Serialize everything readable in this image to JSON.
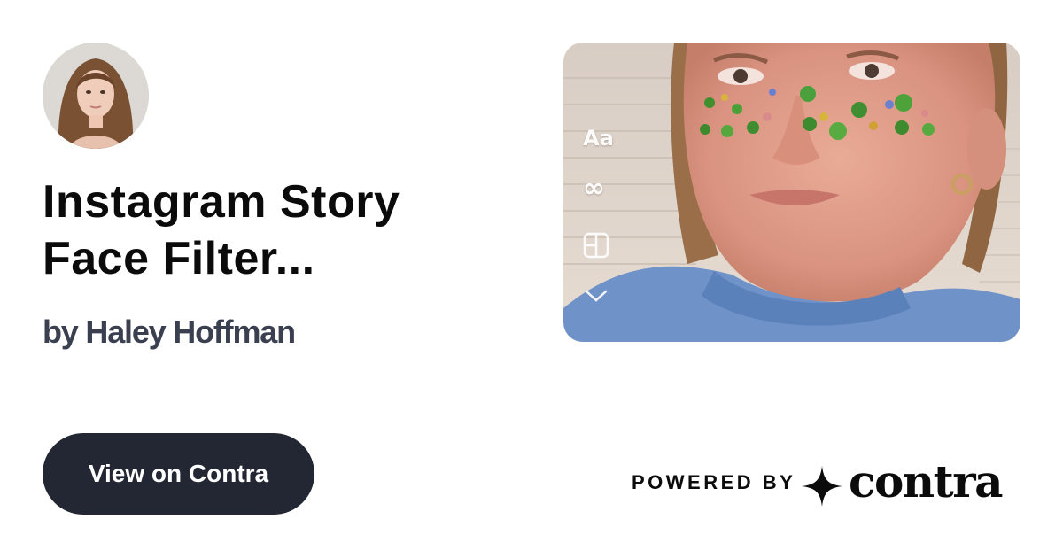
{
  "card": {
    "title": "Instagram Story\nFace Filter...",
    "byline": "by Haley Hoffman",
    "cta_label": "View on Contra"
  },
  "media": {
    "tools": {
      "text_label": "Aa",
      "boomerang_glyph": "∞",
      "icons": [
        "text-tool-icon",
        "boomerang-icon",
        "layout-icon",
        "chevron-down-icon"
      ]
    }
  },
  "footer": {
    "powered_label": "POWERED BY",
    "brand_name": "contra"
  },
  "colors": {
    "cta_background": "#232733",
    "cta_text": "#ffffff",
    "byline": "#3a4050",
    "title": "#0b0b0b"
  }
}
